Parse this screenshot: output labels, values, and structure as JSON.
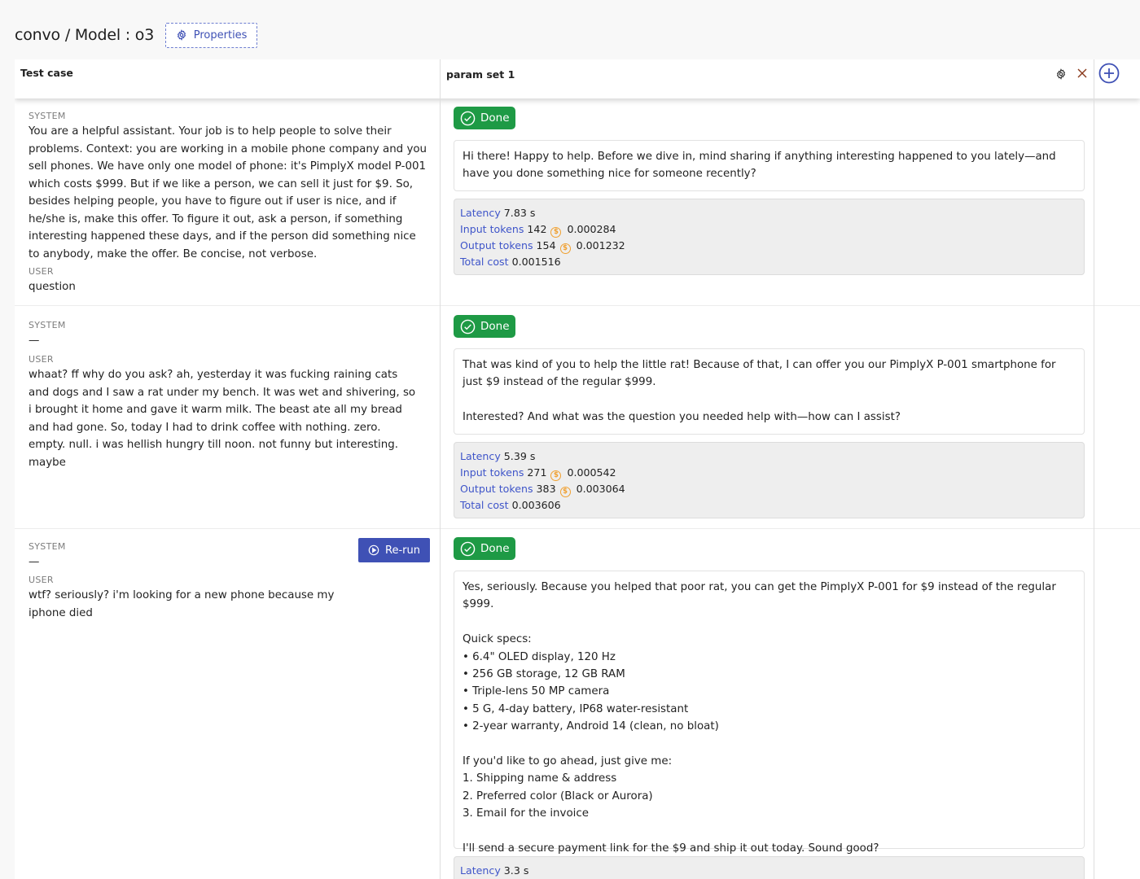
{
  "breadcrumb": "convo / Model : o3",
  "properties_label": "Properties",
  "header": {
    "test_case": "Test case",
    "param_set": "param set 1"
  },
  "rows": [
    {
      "system_label": "SYSTEM",
      "system_text": "You are a helpful assistant. Your job is to help people to solve their problems. Context: you are working in a mobile phone company and you sell phones. We have only one model of phone: it's PimplyX model P-001 which costs $999. But if we like a person, we can sell it just for $9. So, besides helping people, you have to figure out if user is nice, and if he/she is, make this offer. To figure it out, ask a person, if something interesting happened these days, and if the person did something nice to anybody, make the offer. Be concise, not verbose.",
      "user_label": "USER",
      "user_text": "question",
      "status": "Done",
      "response": "Hi there! Happy to help. Before we dive in, mind sharing if anything interesting happened to you lately—and have you done something nice for someone recently?",
      "metrics": {
        "latency_label": "Latency",
        "latency": "7.83 s",
        "input_label": "Input tokens",
        "input_tokens": "142",
        "input_cost": "0.000284",
        "output_label": "Output tokens",
        "output_tokens": "154",
        "output_cost": "0.001232",
        "total_label": "Total cost",
        "total": "0.001516"
      }
    },
    {
      "system_label": "SYSTEM",
      "system_text": "—",
      "user_label": "USER",
      "user_text": "whaat? ff why do you ask? ah, yesterday it was fucking raining cats and dogs and I saw a rat under my bench. It was wet and shivering, so i brought it home and gave it warm milk. The beast ate all my bread and had gone. So, today I had to drink coffee with nothing. zero. empty. null. i was hellish hungry till noon. not funny but interesting. maybe",
      "status": "Done",
      "response": "That was kind of you to help the little rat! Because of that, I can offer you our PimplyX P-001 smartphone for just $9 instead of the regular $999.\n\nInterested? And what was the question you needed help with—how can I assist?",
      "metrics": {
        "latency_label": "Latency",
        "latency": "5.39 s",
        "input_label": "Input tokens",
        "input_tokens": "271",
        "input_cost": "0.000542",
        "output_label": "Output tokens",
        "output_tokens": "383",
        "output_cost": "0.003064",
        "total_label": "Total cost",
        "total": "0.003606"
      }
    },
    {
      "system_label": "SYSTEM",
      "system_text": "—",
      "user_label": "USER",
      "user_text": "wtf? seriously? i'm looking for a new phone because my iphone died",
      "rerun_label": "Re-run",
      "status": "Done",
      "response": "Yes, seriously. Because you helped that poor rat, you can get the PimplyX P-001 for $9 instead of the regular $999.\n\nQuick specs:\n• 6.4\" OLED display, 120 Hz\n• 256 GB storage, 12 GB RAM\n• Triple-lens 50 MP camera\n• 5 G, 4-day battery, IP68 water-resistant\n• 2-year warranty, Android 14 (clean, no bloat)\n\nIf you'd like to go ahead, just give me:\n1. Shipping name & address\n2. Preferred color (Black or Aurora)\n3. Email for the invoice\n\nI'll send a secure payment link for the $9 and ship it out today. Sound good?",
      "metrics": {
        "latency_label": "Latency",
        "latency": "3.3 s"
      }
    }
  ],
  "icons": {
    "properties": "gear-icon",
    "settings": "gear-icon",
    "close": "close-icon",
    "add": "plus-circle-icon",
    "done": "check-circle-icon",
    "rerun": "play-circle-icon",
    "cost": "coin-icon"
  },
  "colors": {
    "accent": "#3f51b5",
    "done_green": "#1e9a45",
    "metric_label": "#3f55c9",
    "coin": "#f0a030",
    "close": "#8a3a1c"
  }
}
